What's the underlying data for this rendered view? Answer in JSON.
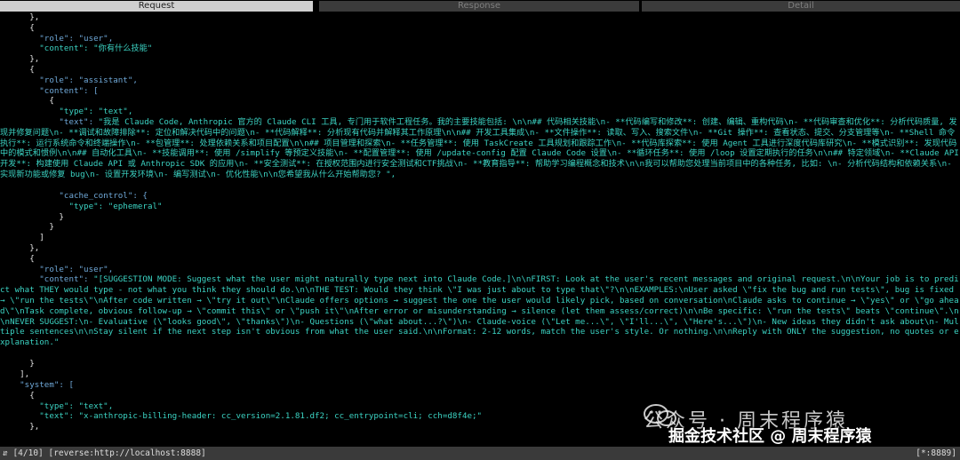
{
  "tabs": {
    "request": "Request",
    "response": "Response",
    "detail": "Detail"
  },
  "lines": {
    "l1": "      },",
    "l2": "      {",
    "l3": "        \"role\": \"user\",",
    "l4": "        \"content\": \"你有什么技能\"",
    "l5": "      },",
    "l6": "      {",
    "l7": "        \"role\": \"assistant\",",
    "l8": "        \"content\": [",
    "l9": "          {",
    "l10": "            \"type\": \"text\",",
    "l11_key": "            \"text\": ",
    "l11_val": "\"我是 Claude Code, Anthropic 官方的 Claude CLI 工具, 专门用于软件工程任务。我的主要技能包括: \\n\\n## 代码相关技能\\n- **代码编写和修改**: 创建、编辑、重构代码\\n- **代码审查和优化**: 分析代码质量, 发现并修复问题\\n- **调试和故障排除**: 定位和解决代码中的问题\\n- **代码解释**: 分析现有代码并解释其工作原理\\n\\n## 开发工具集成\\n- **文件操作**: 读取、写入、搜索文件\\n- **Git 操作**: 查看状态、提交、分支管理等\\n- **Shell 命令执行**: 运行系统命令和终端操作\\n- **包管理**: 处理依赖关系和项目配置\\n\\n## 项目管理和探索\\n- **任务管理**: 使用 TaskCreate 工具规划和跟踪工作\\n- **代码库探索**: 使用 Agent 工具进行深度代码库研究\\n- **模式识别**: 发现代码中的模式和惯例\\n\\n## 自动化工具\\n- **技能调用**: 使用 /simplify 等预定义技能\\n- **配置管理**: 使用 /update-config 配置 Claude Code 设置\\n- **循环任务**: 使用 /loop 设置定期执行的任务\\n\\n## 特定领域\\n- **Claude API 开发**: 构建使用 Claude API 或 Anthropic SDK 的应用\\n- **安全测试**: 在授权范围内进行安全测试和CTF挑战\\n- **教育指导**: 帮助学习编程概念和技术\\n\\n我可以帮助您处理当前项目中的各种任务, 比如: \\n- 分析代码结构和依赖关系\\n- 实现新功能或修复 bug\\n- 设置开发环境\\n- 编写测试\\n- 优化性能\\n\\n您希望我从什么开始帮助您? \",",
    "l12": "            \"cache_control\": {",
    "l13": "              \"type\": \"ephemeral\"",
    "l14": "            }",
    "l15": "          }",
    "l16": "        ]",
    "l17": "      },",
    "l18": "      {",
    "l19": "        \"role\": \"user\",",
    "l20_key": "        \"content\": ",
    "l20_val": "\"[SUGGESTION MODE: Suggest what the user might naturally type next into Claude Code.]\\n\\nFIRST: Look at the user's recent messages and original request.\\n\\nYour job is to predict what THEY would type - not what you think they should do.\\n\\nTHE TEST: Would they think \\\"I was just about to type that\\\"?\\n\\nEXAMPLES:\\nUser asked \\\"fix the bug and run tests\\\", bug is fixed → \\\"run the tests\\\"\\nAfter code written → \\\"try it out\\\"\\nClaude offers options → suggest the one the user would likely pick, based on conversation\\nClaude asks to continue → \\\"yes\\\" or \\\"go ahead\\\"\\nTask complete, obvious follow-up → \\\"commit this\\\" or \\\"push it\\\"\\nAfter error or misunderstanding → silence (let them assess/correct)\\n\\nBe specific: \\\"run the tests\\\" beats \\\"continue\\\".\\n\\nNEVER SUGGEST:\\n- Evaluative (\\\"looks good\\\", \\\"thanks\\\")\\n- Questions (\\\"what about...?\\\")\\n- Claude-voice (\\\"Let me...\\\", \\\"I'll...\\\", \\\"Here's...\\\")\\n- New ideas they didn't ask about\\n- Multiple sentences\\n\\nStay silent if the next step isn't obvious from what the user said.\\n\\nFormat: 2-12 words, match the user's style. Or nothing.\\n\\nReply with ONLY the suggestion, no quotes or explanation.\"",
    "l21": "      }",
    "l22": "    ],",
    "l23": "    \"system\": [",
    "l24": "      {",
    "l25": "        \"type\": \"text\",",
    "l26": "        \"text\": \"x-anthropic-billing-header: cc_version=2.1.81.df2; cc_entrypoint=cli; cch=d8f4e;\"",
    "l27": "      },"
  },
  "watermark": {
    "top": "公众号 · 周末程序猿",
    "bottom": "掘金技术社区 @ 周末程序猿"
  },
  "status": {
    "left": "⇵ [4/10] [reverse:http://localhost:8888]",
    "right": "[*:8889]"
  }
}
